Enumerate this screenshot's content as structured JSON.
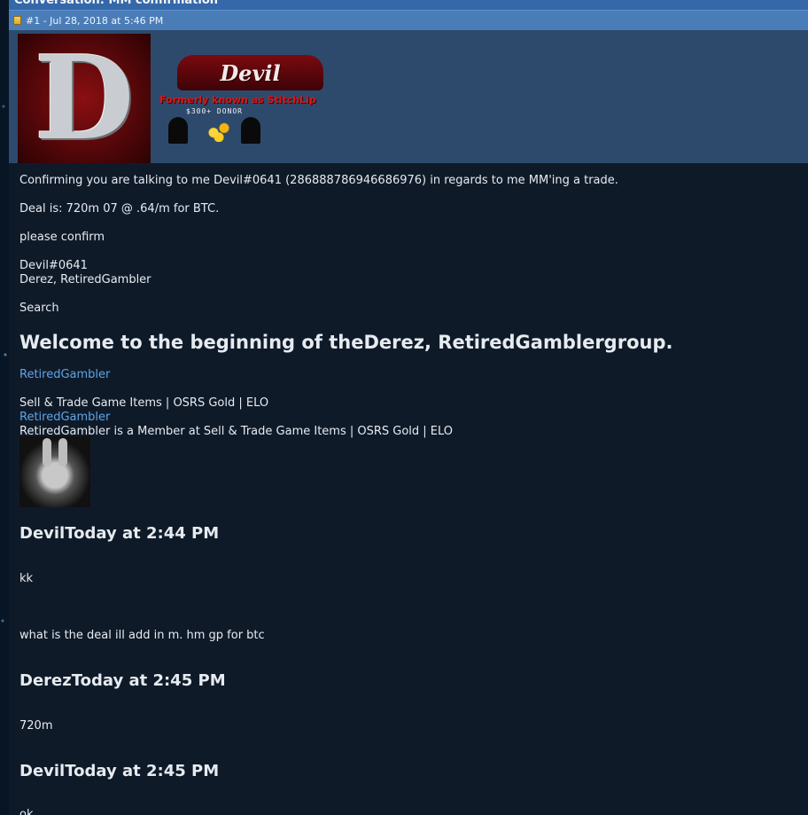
{
  "window": {
    "title": "Conversation: MM confirmation"
  },
  "post": {
    "header": "#1 - Jul 28, 2018 at 5:46 PM"
  },
  "signature": {
    "banner_text": "Devil",
    "formerly": "Formerly known as StitchLip",
    "donor": "$300+ DONOR"
  },
  "message": {
    "line1": "Confirming you are talking to me Devil#0641 (286888786946686976) in regards to me MM'ing a trade.",
    "line2": "Deal is: 720m 07 @ .64/m for BTC.",
    "line3": "please confirm",
    "line4": "Devil#0641",
    "line5": "Derez, RetiredGambler",
    "line6": "Search",
    "welcome": "Welcome to the beginning of theDerez, RetiredGamblergroup.",
    "member_link1": "RetiredGambler",
    "group_name": "Sell & Trade Game Items | OSRS Gold | ELO",
    "member_link2": "RetiredGambler",
    "member_desc": "RetiredGambler is a Member at Sell & Trade Game Items | OSRS Gold | ELO"
  },
  "chat": [
    {
      "header": "DevilToday at 2:44 PM",
      "lines": [
        "kk",
        "what is the deal ill add in m. hm gp for btc"
      ]
    },
    {
      "header": "DerezToday at 2:45 PM",
      "lines": [
        "720m"
      ]
    },
    {
      "header": "DevilToday at 2:45 PM",
      "lines": [
        "ok"
      ]
    }
  ],
  "colors": {
    "background": "#0f1a29",
    "titlebar": "#3568a8",
    "postbar": "#4a7db8",
    "sigpanel": "#2d4a6c",
    "link": "#5fa5e6",
    "text": "#e6ebf0"
  }
}
